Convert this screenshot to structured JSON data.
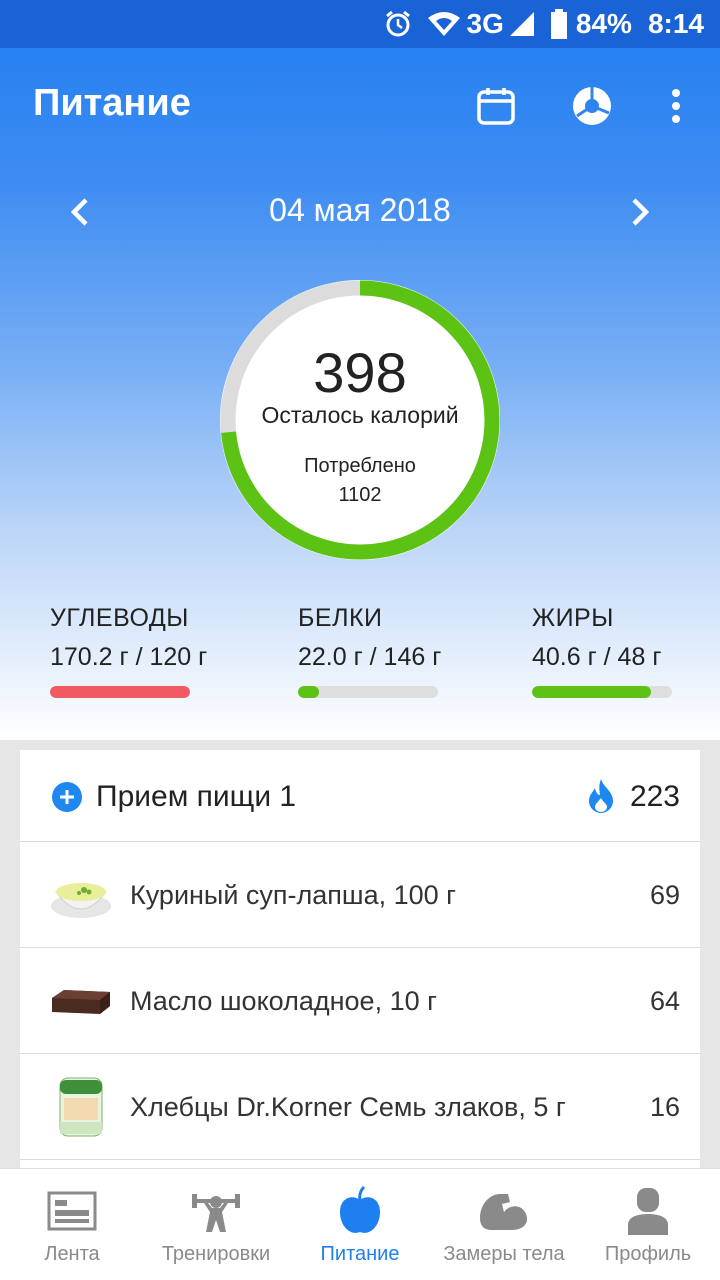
{
  "status_bar": {
    "network": "3G",
    "battery": "84%",
    "time": "8:14",
    "icons": [
      "alarm-icon",
      "wifi-icon",
      "signal-icon",
      "battery-icon"
    ]
  },
  "app_bar": {
    "title": "Питание",
    "actions": [
      "calendar-icon",
      "pie-chart-icon",
      "more-icon"
    ]
  },
  "date_nav": {
    "date": "04 мая 2018"
  },
  "calories": {
    "remaining_value": "398",
    "remaining_label": "Осталось калорий",
    "consumed_label": "Потреблено",
    "consumed_value": "1102",
    "progress_fraction": 0.735,
    "colors": {
      "progress": "#5cc214",
      "track": "#dcdcdc"
    }
  },
  "macros": [
    {
      "name": "УГЛЕВОДЫ",
      "amount": "170.2 г / 120 г",
      "fraction": 1.0,
      "color": "#f25a63"
    },
    {
      "name": "БЕЛКИ",
      "amount": "22.0 г / 146 г",
      "fraction": 0.15,
      "color": "#5cc214"
    },
    {
      "name": "ЖИРЫ",
      "amount": "40.6 г / 48 г",
      "fraction": 0.85,
      "color": "#5cc214"
    }
  ],
  "meal": {
    "title": "Прием пищи 1",
    "total": "223",
    "items": [
      {
        "name": "Куриный суп-лапша, 100 г",
        "calories": "69",
        "thumb": "soup-thumbnail"
      },
      {
        "name": "Масло шоколадное, 10 г",
        "calories": "64",
        "thumb": "chocolate-butter-thumbnail"
      },
      {
        "name": "Хлебцы Dr.Korner Семь злаков, 5 г",
        "calories": "16",
        "thumb": "crispbread-thumbnail"
      }
    ]
  },
  "bottom_nav": {
    "items": [
      {
        "label": "Лента",
        "icon": "feed-icon"
      },
      {
        "label": "Тренировки",
        "icon": "workout-icon"
      },
      {
        "label": "Питание",
        "icon": "apple-icon",
        "active": true
      },
      {
        "label": "Замеры тела",
        "icon": "bicep-icon"
      },
      {
        "label": "Профиль",
        "icon": "profile-icon"
      }
    ],
    "active_color": "#1e7ff0",
    "inactive_color": "#8a8a8a"
  }
}
